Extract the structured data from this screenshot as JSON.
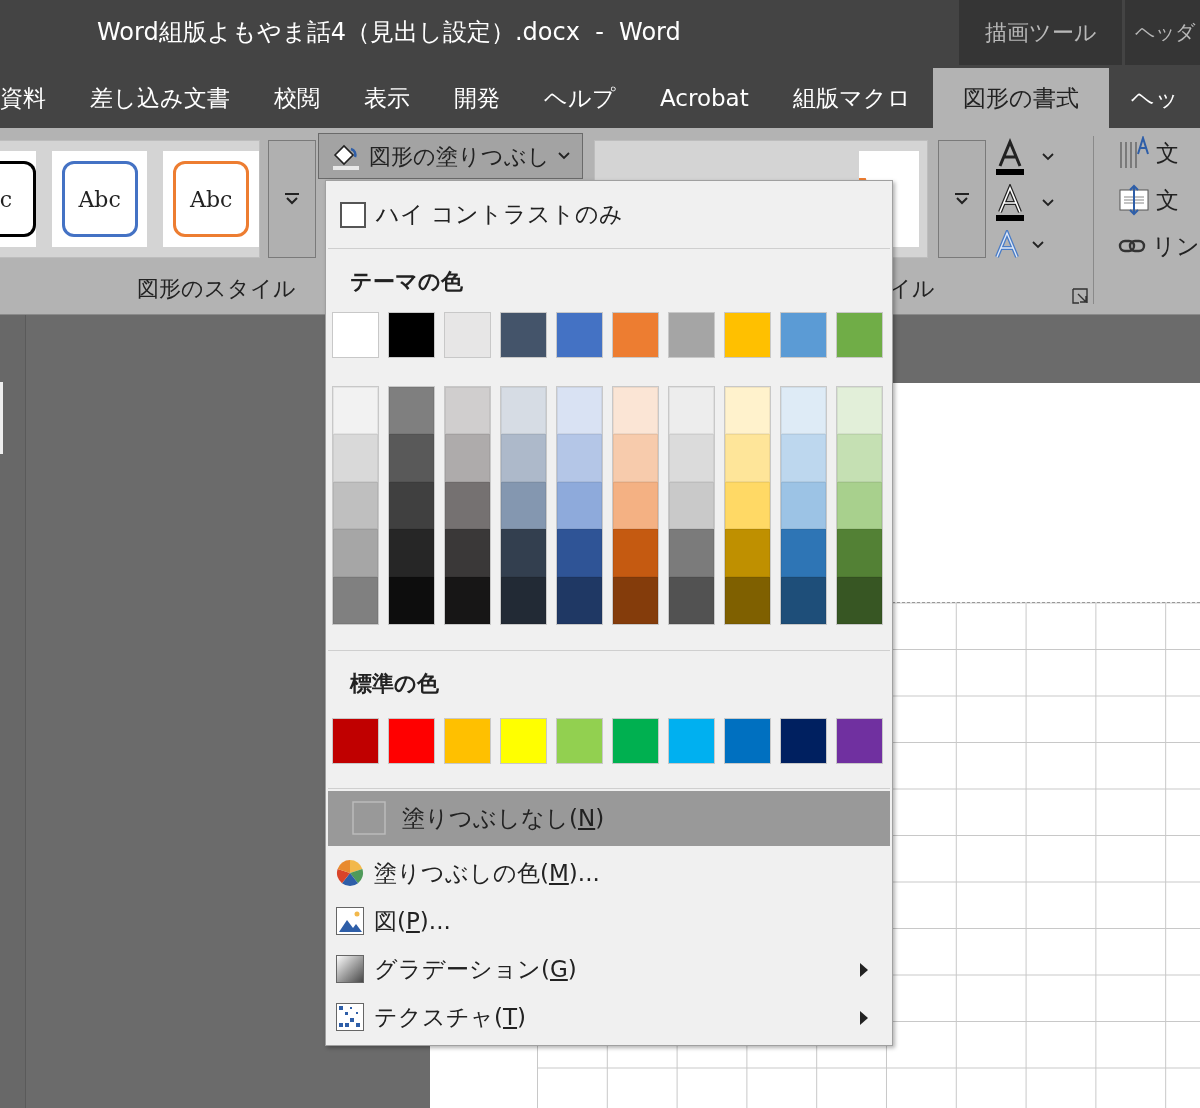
{
  "window": {
    "title": "Word組版よもやま話4（見出し設定）.docx  -  Word",
    "context_tabs": [
      {
        "label": "描画ツール"
      },
      {
        "label": "ヘッダ"
      }
    ]
  },
  "ribbon_tabs": [
    {
      "label": "資料",
      "selected": false
    },
    {
      "label": "差し込み文書",
      "selected": false
    },
    {
      "label": "校閲",
      "selected": false
    },
    {
      "label": "表示",
      "selected": false
    },
    {
      "label": "開発",
      "selected": false
    },
    {
      "label": "ヘルプ",
      "selected": false
    },
    {
      "label": "Acrobat",
      "selected": false
    },
    {
      "label": "組版マクロ",
      "selected": false
    },
    {
      "label": "図形の書式",
      "selected": true
    },
    {
      "label": "ヘッ",
      "selected": false
    }
  ],
  "ribbon": {
    "shape_styles": {
      "thumbnails": [
        {
          "text": "c",
          "color": "#000000"
        },
        {
          "text": "Abc",
          "color": "#4472c4"
        },
        {
          "text": "Abc",
          "color": "#ed7d31"
        }
      ],
      "label": "図形のスタイル"
    },
    "fill_button": {
      "label": "図形の塗りつぶし"
    },
    "wordart_styles": {
      "label": "イル"
    },
    "text_commands": [
      {
        "label": "文"
      },
      {
        "label": "文"
      },
      {
        "label": "リン"
      }
    ]
  },
  "fill_menu": {
    "high_contrast": {
      "label": "ハイ コントラストのみ",
      "checked": false
    },
    "theme_heading": "テーマの色",
    "theme_colors": [
      {
        "color": "#ffffff",
        "shades": [
          {
            "color": "#f2f2f2"
          },
          {
            "color": "#d9d9d9"
          },
          {
            "color": "#bfbfbf"
          },
          {
            "color": "#a6a6a6"
          },
          {
            "color": "#808080"
          }
        ]
      },
      {
        "color": "#000000",
        "shades": [
          {
            "color": "#7f7f7f"
          },
          {
            "color": "#595959"
          },
          {
            "color": "#404040"
          },
          {
            "color": "#262626"
          },
          {
            "color": "#0d0d0d"
          }
        ]
      },
      {
        "color": "#e7e6e6",
        "shades": [
          {
            "color": "#d0cece"
          },
          {
            "color": "#aeabab"
          },
          {
            "color": "#757171"
          },
          {
            "color": "#3a3838"
          },
          {
            "color": "#171616"
          }
        ]
      },
      {
        "color": "#44546a",
        "shades": [
          {
            "color": "#d6dce4"
          },
          {
            "color": "#adb9ca"
          },
          {
            "color": "#8497b0"
          },
          {
            "color": "#333f4f"
          },
          {
            "color": "#222a35"
          }
        ]
      },
      {
        "color": "#4472c4",
        "shades": [
          {
            "color": "#d9e2f3"
          },
          {
            "color": "#b4c6e7"
          },
          {
            "color": "#8eaadb"
          },
          {
            "color": "#2f5496"
          },
          {
            "color": "#1f3864"
          }
        ]
      },
      {
        "color": "#ed7d31",
        "shades": [
          {
            "color": "#fbe5d5"
          },
          {
            "color": "#f7cbac"
          },
          {
            "color": "#f4b183"
          },
          {
            "color": "#c55a11"
          },
          {
            "color": "#843c0b"
          }
        ]
      },
      {
        "color": "#a5a5a5",
        "shades": [
          {
            "color": "#ededed"
          },
          {
            "color": "#dbdbdb"
          },
          {
            "color": "#c9c9c9"
          },
          {
            "color": "#7b7b7b"
          },
          {
            "color": "#525252"
          }
        ]
      },
      {
        "color": "#ffc000",
        "shades": [
          {
            "color": "#fff2cc"
          },
          {
            "color": "#fee599"
          },
          {
            "color": "#ffd965"
          },
          {
            "color": "#bf9000"
          },
          {
            "color": "#7f6000"
          }
        ]
      },
      {
        "color": "#5b9bd5",
        "shades": [
          {
            "color": "#deebf6"
          },
          {
            "color": "#bdd7ee"
          },
          {
            "color": "#9cc3e5"
          },
          {
            "color": "#2e75b5"
          },
          {
            "color": "#1e4e79"
          }
        ]
      },
      {
        "color": "#70ad47",
        "shades": [
          {
            "color": "#e2efd9"
          },
          {
            "color": "#c5e0b3"
          },
          {
            "color": "#a8d08d"
          },
          {
            "color": "#538135"
          },
          {
            "color": "#375623"
          }
        ]
      }
    ],
    "standard_heading": "標準の色",
    "standard_colors": [
      {
        "color": "#c00000"
      },
      {
        "color": "#ff0000"
      },
      {
        "color": "#ffc000"
      },
      {
        "color": "#ffff00"
      },
      {
        "color": "#92d050"
      },
      {
        "color": "#00b050"
      },
      {
        "color": "#00b0f0"
      },
      {
        "color": "#0070c0"
      },
      {
        "color": "#002060"
      },
      {
        "color": "#7030a0"
      }
    ],
    "items": [
      {
        "kind": "no_fill",
        "label": "塗りつぶしなし(",
        "accelerator": "N",
        "suffix": ")",
        "highlighted": true,
        "submenu": false
      },
      {
        "kind": "color",
        "label": "塗りつぶしの色(",
        "accelerator": "M",
        "suffix": ")...",
        "highlighted": false,
        "submenu": false
      },
      {
        "kind": "picture",
        "label": "図(",
        "accelerator": "P",
        "suffix": ")...",
        "highlighted": false,
        "submenu": false
      },
      {
        "kind": "gradient",
        "label": "グラデーション(",
        "accelerator": "G",
        "suffix": ")",
        "highlighted": false,
        "submenu": true
      },
      {
        "kind": "texture",
        "label": "テクスチャ(",
        "accelerator": "T",
        "suffix": ")",
        "highlighted": false,
        "submenu": true
      }
    ]
  }
}
